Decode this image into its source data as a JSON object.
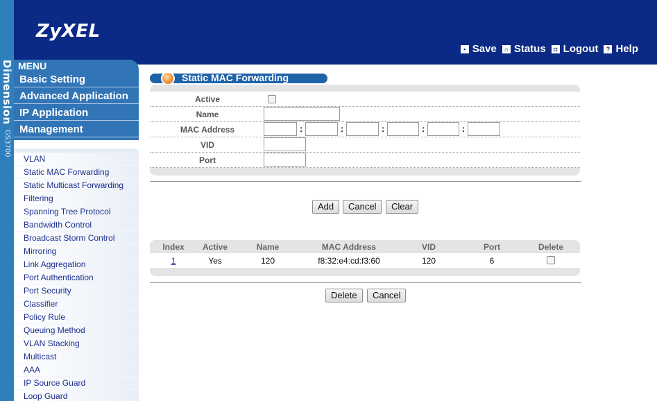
{
  "brand": {
    "logo": "ZyXEL",
    "strip_text": "Dimension",
    "strip_model": "GS3700"
  },
  "header": {
    "links": [
      {
        "label": "Save",
        "icon": "save-icon"
      },
      {
        "label": "Status",
        "icon": "home-icon"
      },
      {
        "label": "Logout",
        "icon": "logout-icon"
      },
      {
        "label": "Help",
        "icon": "help-icon"
      }
    ]
  },
  "menu": {
    "title": "MENU",
    "categories": [
      "Basic Setting",
      "Advanced Application",
      "IP Application",
      "Management"
    ],
    "sub_items": [
      "VLAN",
      "Static MAC Forwarding",
      "Static Multicast Forwarding",
      "Filtering",
      "Spanning Tree Protocol",
      "Bandwidth Control",
      "Broadcast Storm Control",
      "Mirroring",
      "Link Aggregation",
      "Port Authentication",
      "Port Security",
      "Classifier",
      "Policy Rule",
      "Queuing Method",
      "VLAN Stacking",
      "Multicast",
      "AAA",
      "IP Source Guard",
      "Loop Guard"
    ]
  },
  "page": {
    "title": "Static MAC Forwarding"
  },
  "form": {
    "active_label": "Active",
    "name_label": "Name",
    "name_value": "",
    "mac_label": "MAC Address",
    "mac_segments": [
      "",
      "",
      "",
      "",
      "",
      ""
    ],
    "mac_separator": ":",
    "vid_label": "VID",
    "vid_value": "",
    "port_label": "Port",
    "port_value": ""
  },
  "form_buttons": {
    "add": "Add",
    "cancel": "Cancel",
    "clear": "Clear"
  },
  "table": {
    "columns": [
      "Index",
      "Active",
      "Name",
      "MAC Address",
      "VID",
      "Port",
      "Delete"
    ],
    "rows": [
      {
        "index": "1",
        "active": "Yes",
        "name": "120",
        "mac": "f8:32:e4:cd:f3:60",
        "vid": "120",
        "port": "6",
        "delete": false
      }
    ]
  },
  "table_buttons": {
    "delete": "Delete",
    "cancel": "Cancel"
  },
  "colors": {
    "header_bg": "#0b2a85",
    "menu_bg": "#3175b6",
    "title_bar": "#1e63a8",
    "link_text": "#1d2f8e"
  }
}
